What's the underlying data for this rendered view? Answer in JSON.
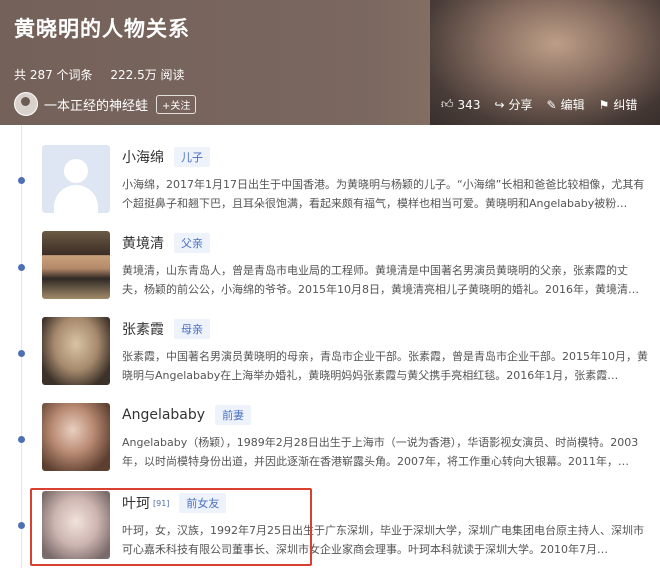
{
  "header": {
    "title": "黄晓明的人物关系",
    "entry_count": "共 287 个词条",
    "read_count": "222.5万 阅读",
    "author_name": "一本正经的神经蛙",
    "follow_label": "+关注",
    "like_count": "343",
    "share_label": "分享",
    "edit_label": "编辑",
    "report_label": "纠错"
  },
  "entries": [
    {
      "name": "小海绵",
      "ref": "",
      "relation": "儿子",
      "desc": "小海绵，2017年1月17日出生于中国香港。为黄晓明与杨颖的儿子。“小海绵”长相和爸爸比较相像，尤其有个超挺鼻子和翘下巴，且耳朵很饱满，看起来颇有福气，模样也相当可爱。黄晓明和Angelababy被粉…"
    },
    {
      "name": "黄境清",
      "ref": "",
      "relation": "父亲",
      "desc": "黄境清，山东青岛人，曾是青岛市电业局的工程师。黄境清是中国著名男演员黄晓明的父亲，张素霞的丈夫，杨颖的前公公，小海绵的爷爷。2015年10月8日，黄境清亮相儿子黄晓明的婚礼。2016年，黄境清…"
    },
    {
      "name": "张素霞",
      "ref": "",
      "relation": "母亲",
      "desc": "张素霞，中国著名男演员黄晓明的母亲，青岛市企业干部。张素霞，曾是青岛市企业干部。2015年10月，黄晓明与Angelababy在上海举办婚礼，黄晓明妈妈张素霞与黄父携手亮相红毯。2016年1月，张素霞…"
    },
    {
      "name": "Angelababy",
      "ref": "",
      "relation": "前妻",
      "desc": "Angelababy（杨颖），1989年2月28日出生于上海市（一说为香港），华语影视女演员、时尚模特。2003年，以时尚模特身份出道，并因此逐渐在香港崭露头角。2007年，将工作重心转向大银幕。2011年，…"
    },
    {
      "name": "叶珂",
      "ref": "[91]",
      "relation": "前女友",
      "desc": "叶珂，女，汉族，1992年7月25日出生于广东深圳，毕业于深圳大学，深圳广电集团电台原主持人、深圳市可心嘉禾科技有限公司董事长、深圳市女企业家商会理事。叶珂本科就读于深圳大学。2010年7月…"
    }
  ],
  "colors": {
    "accent": "#4f6fb5",
    "highlight_border": "#d9402f"
  }
}
